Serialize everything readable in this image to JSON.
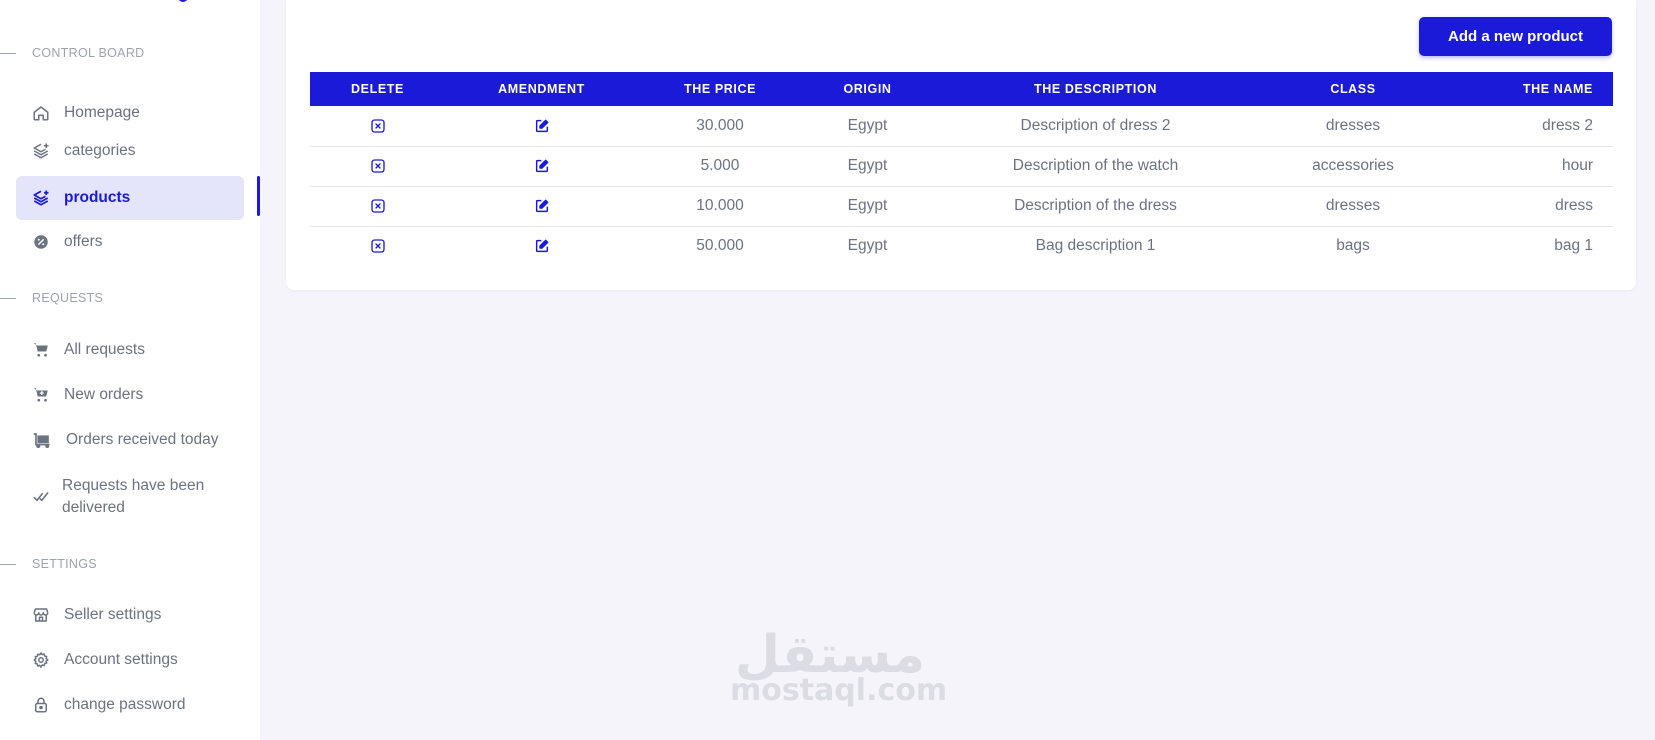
{
  "sidebar": {
    "sections": [
      {
        "title": "CONTROL BOARD",
        "items": [
          {
            "label": "Homepage",
            "icon": "home-icon"
          },
          {
            "label": "categories",
            "icon": "layers-plus-icon"
          },
          {
            "label": "products",
            "icon": "layers-plus-icon",
            "active": true
          },
          {
            "label": "offers",
            "icon": "discount-badge-icon"
          }
        ]
      },
      {
        "title": "REQUESTS",
        "items": [
          {
            "label": "All requests",
            "icon": "cart-icon"
          },
          {
            "label": "New orders",
            "icon": "cart-plus-icon"
          },
          {
            "label": "Orders received today",
            "icon": "cart-dolly-icon"
          },
          {
            "label": "Requests have been delivered",
            "icon": "double-check-icon"
          }
        ]
      },
      {
        "title": "SETTINGS",
        "items": [
          {
            "label": "Seller settings",
            "icon": "store-icon"
          },
          {
            "label": "Account settings",
            "icon": "gear-icon"
          },
          {
            "label": "change password",
            "icon": "lock-icon"
          }
        ]
      }
    ]
  },
  "main": {
    "add_button_label": "Add a new product",
    "table": {
      "headers": [
        "DELETE",
        "AMENDMENT",
        "THE PRICE",
        "ORIGIN",
        "THE DESCRIPTION",
        "CLASS",
        "THE NAME"
      ],
      "rows": [
        {
          "price": "30.000",
          "origin": "Egypt",
          "description": "Description of dress 2",
          "class": "dresses",
          "name": "dress 2"
        },
        {
          "price": "5.000",
          "origin": "Egypt",
          "description": "Description of the watch",
          "class": "accessories",
          "name": "hour"
        },
        {
          "price": "10.000",
          "origin": "Egypt",
          "description": "Description of the dress",
          "class": "dresses",
          "name": "dress"
        },
        {
          "price": "50.000",
          "origin": "Egypt",
          "description": "Bag description 1",
          "class": "bags",
          "name": "bag 1"
        }
      ],
      "row_icons": {
        "delete": "delete-x-icon",
        "edit": "edit-pencil-icon"
      }
    }
  },
  "watermark": {
    "logo_text": "مستقل",
    "url": "mostaql.com"
  },
  "colors": {
    "accent": "#1a1ad8",
    "active_bg": "#e4e4fb",
    "page_bg": "#f4f4fa",
    "text_muted": "#6b7280"
  }
}
